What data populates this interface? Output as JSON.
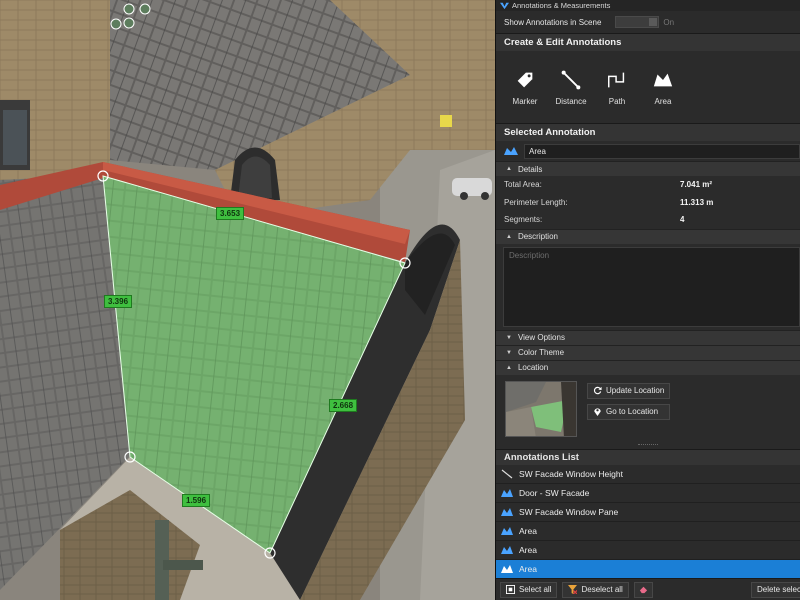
{
  "viewport": {
    "measurements": [
      "3.653",
      "3.396",
      "2.668",
      "1.596"
    ]
  },
  "panel": {
    "title": "Annotations & Measurements",
    "show_label": "Show Annotations in Scene",
    "show_state": "On",
    "create_header": "Create & Edit Annotations",
    "tools": [
      {
        "label": "Marker"
      },
      {
        "label": "Distance"
      },
      {
        "label": "Path"
      },
      {
        "label": "Area"
      }
    ],
    "selected_header": "Selected Annotation",
    "selected_name": "Area",
    "details_label": "Details",
    "details": [
      {
        "key": "Total Area:",
        "value": "7.041 m²"
      },
      {
        "key": "Perimeter Length:",
        "value": "11.313 m"
      },
      {
        "key": "Segments:",
        "value": "4"
      }
    ],
    "description_label": "Description",
    "description_placeholder": "Description",
    "view_options_label": "View Options",
    "color_theme_label": "Color Theme",
    "location_label": "Location",
    "update_location": "Update Location",
    "go_to_location": "Go to Location",
    "list_header": "Annotations List",
    "list": [
      {
        "label": "SW Facade Window Height",
        "icon": "distance-icon"
      },
      {
        "label": "Door - SW Facade",
        "icon": "area-icon"
      },
      {
        "label": "SW Facade Window Pane",
        "icon": "area-icon"
      },
      {
        "label": "Area",
        "icon": "area-icon"
      },
      {
        "label": "Area",
        "icon": "area-icon"
      },
      {
        "label": "Area",
        "icon": "area-icon",
        "selected": true
      }
    ],
    "select_all": "Select all",
    "deselect_all": "Deselect all",
    "delete_selected": "Delete selec"
  },
  "colors": {
    "accent": "#1b7fd6",
    "area_fill": "#7fe07f",
    "measure_label": "#3fbf3f"
  }
}
